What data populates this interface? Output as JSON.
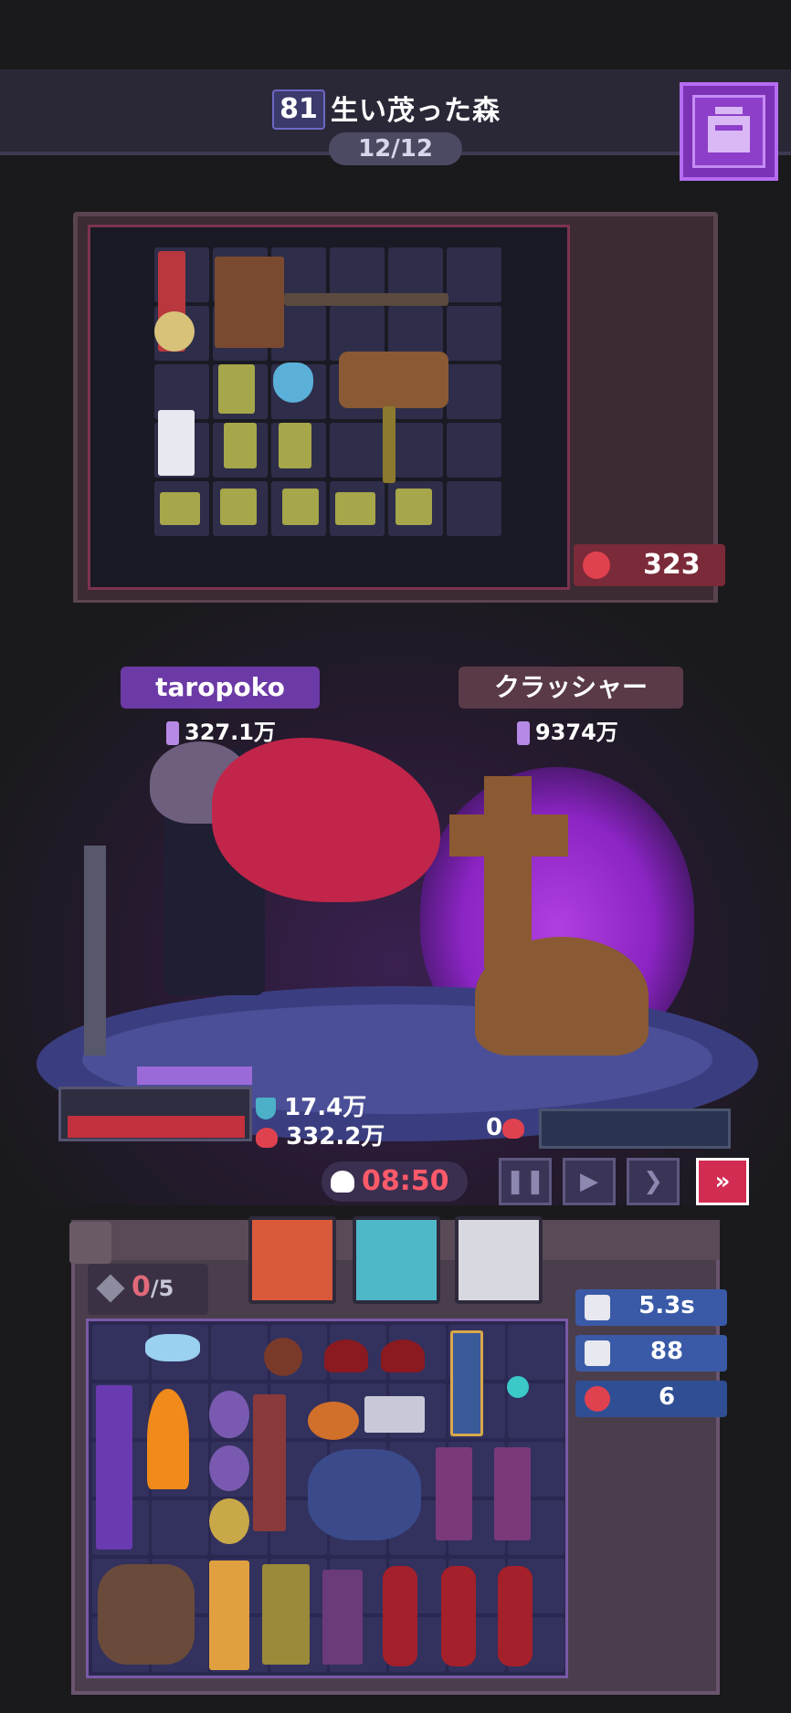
{
  "header": {
    "stage_number": "81",
    "stage_name": "生い茂った森",
    "wave_progress": "12/12",
    "bag_button_icon": "backpack-icon"
  },
  "enemy_board": {
    "rage_icon": "rage-flame-icon",
    "rage_value": "323",
    "items": [
      "medal-icon",
      "hammer-icon",
      "potion-icon",
      "axe-icon",
      "tower-icon",
      "leaf-icon"
    ]
  },
  "battle": {
    "player": {
      "name": "taropoko",
      "power": "327.1万",
      "shield": "17.4万",
      "hp": "332.2万",
      "hp_fraction": 1.0
    },
    "enemy": {
      "name": "クラッシャー",
      "power": "9374万",
      "hp": "0",
      "hp_fraction": 0.0
    },
    "timer": "08:50",
    "speed_controls": [
      {
        "name": "pause",
        "symbol": "❚❚"
      },
      {
        "name": "play",
        "symbol": "▶"
      },
      {
        "name": "fast",
        "symbol": "❯"
      },
      {
        "name": "fastest",
        "symbol": "»",
        "active": true
      }
    ]
  },
  "inventory": {
    "gems": "0",
    "gems_max": "/5",
    "portraits": [
      "fox-portrait",
      "ghost-portrait",
      "wolf-portrait"
    ],
    "stats": [
      {
        "icon": "cooldown-icon",
        "value": "5.3s"
      },
      {
        "icon": "crossed-swords-icon",
        "value": "88"
      },
      {
        "icon": "fang-icon",
        "value": "6"
      }
    ]
  },
  "colors": {
    "accent": "#7c32b5",
    "hp_red": "#c3303e",
    "rage_red": "#7a2a38",
    "timer_red": "#ff5a6a"
  }
}
